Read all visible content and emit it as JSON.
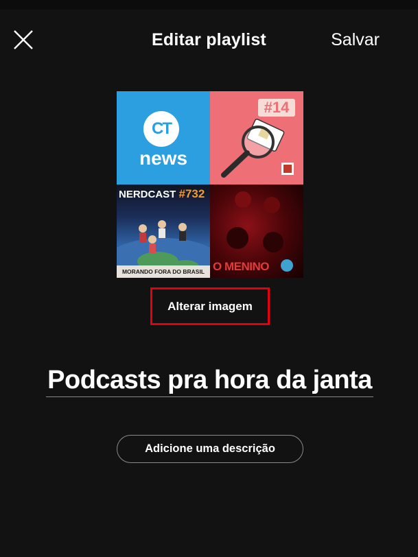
{
  "header": {
    "title": "Editar playlist",
    "save_label": "Salvar",
    "close_icon": "close-icon"
  },
  "cover": {
    "tiles": [
      {
        "name": "cover-tile-canaltech-news",
        "lines": [
          "CT",
          "news"
        ],
        "bg": "#2c9fe0"
      },
      {
        "name": "cover-tile-episode-14",
        "lines": [
          "#14"
        ],
        "bg": "#ee6f76"
      },
      {
        "name": "cover-tile-nerdcast",
        "lines": [
          "NERDCAST",
          "#732",
          "MORANDO FORA DO BRASIL"
        ]
      },
      {
        "name": "cover-tile-o-menino",
        "lines": [
          "O MENINO"
        ]
      }
    ],
    "change_image_label": "Alterar imagem"
  },
  "playlist": {
    "name": "Podcasts pra hora da janta",
    "description_button": "Adicione uma descrição"
  },
  "colors": {
    "background": "#121212",
    "highlight_border": "#e5000f",
    "text": "#ffffff"
  }
}
